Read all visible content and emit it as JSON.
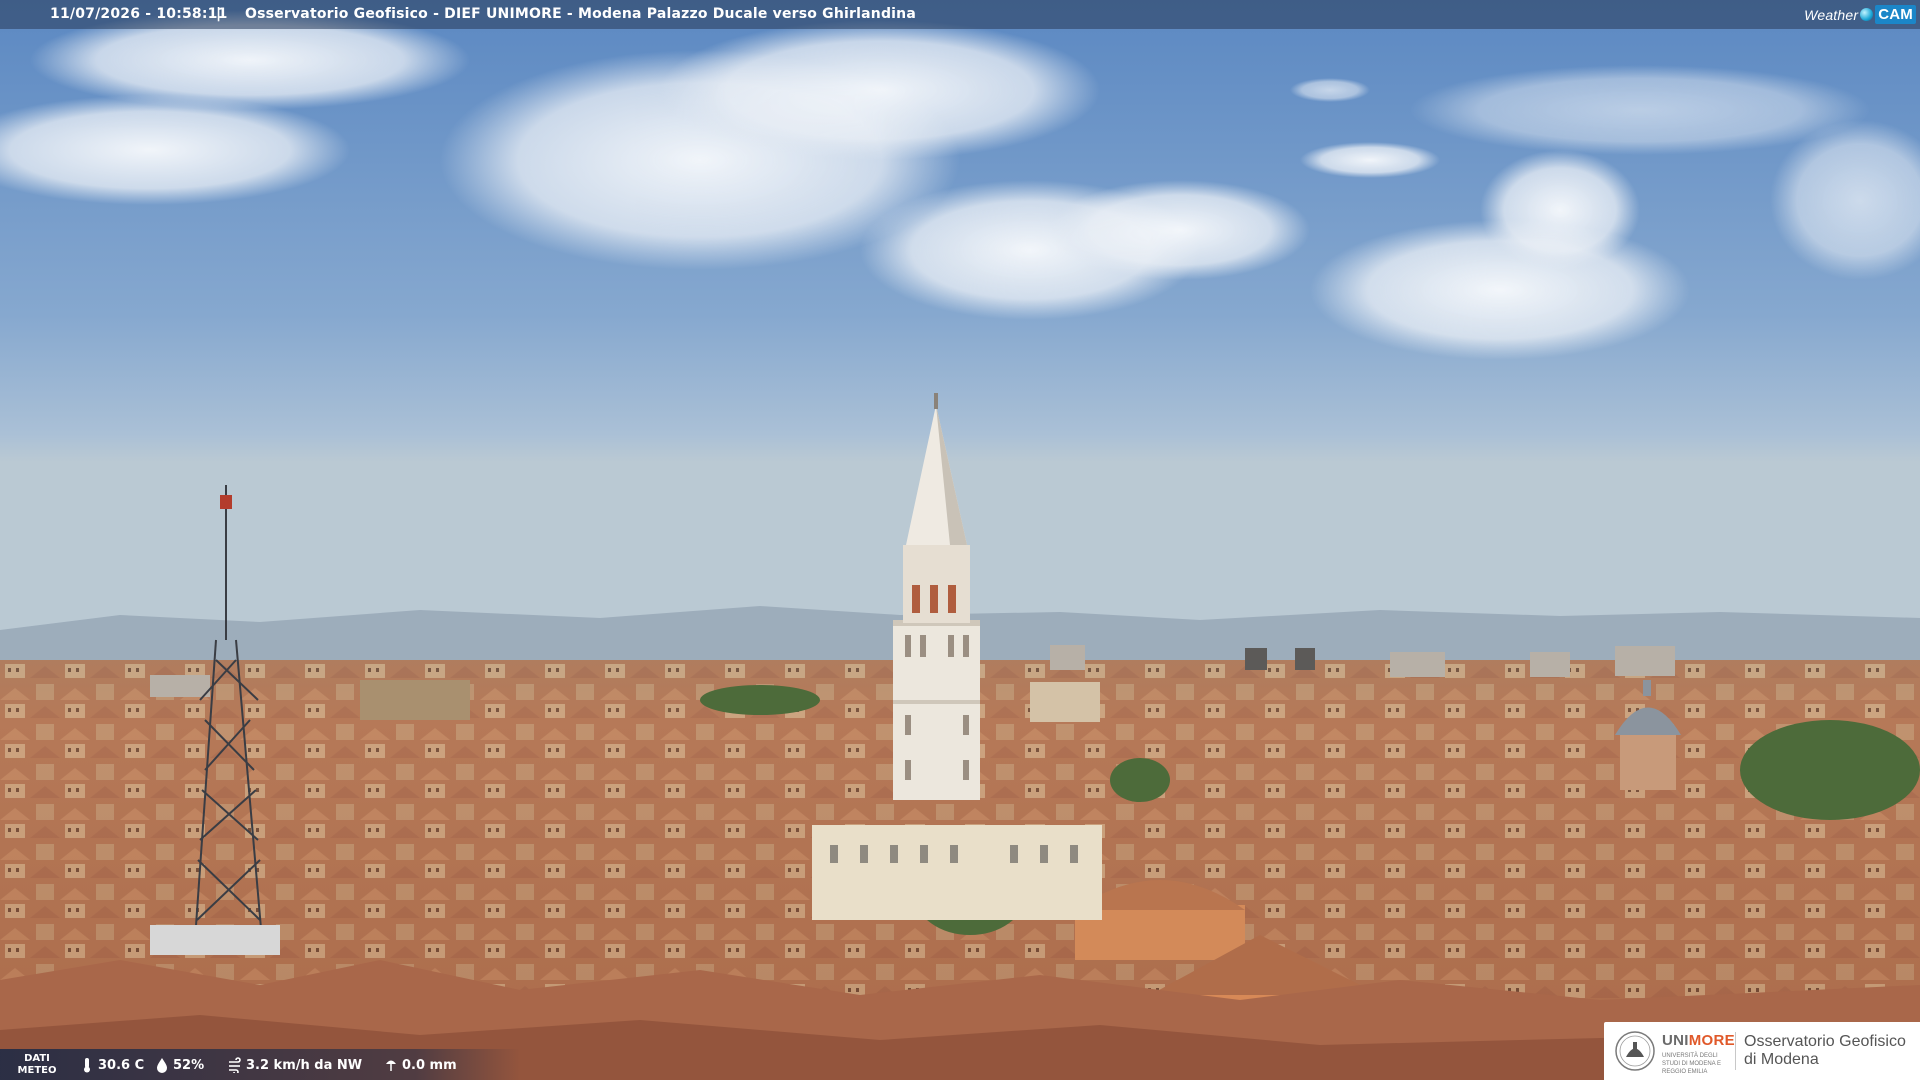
{
  "topbar": {
    "timestamp": "11/07/2026 - 10:58:11",
    "separator": "|",
    "title": "Osservatorio Geofisico - DIEF UNIMORE - Modena Palazzo Ducale verso Ghirlandina"
  },
  "brand": {
    "weather": "Weather",
    "cam": "CAM"
  },
  "meteo": {
    "label_line1": "DATI",
    "label_line2": "METEO",
    "temperature": "30.6 C",
    "humidity": "52%",
    "wind": "3.2 km/h da NW",
    "rain": "0.0 mm",
    "icons": [
      "thermometer-icon",
      "humidity-drop-icon",
      "wind-icon",
      "rain-gauge-icon"
    ]
  },
  "logo": {
    "uni_part1": "UNI",
    "uni_part2": "MORE",
    "uni_sub": "UNIVERSITÀ DEGLI STUDI DI MODENA E REGGIO EMILIA",
    "obs_line1": "Osservatorio Geofisico",
    "obs_line2": "di Modena"
  },
  "colors": {
    "sky_top": "#5f8cc4",
    "sky_horizon": "#b9cbd8",
    "roof": "#b8734e",
    "tower": "#e9e4da",
    "accent_unimore": "#e0592a"
  }
}
